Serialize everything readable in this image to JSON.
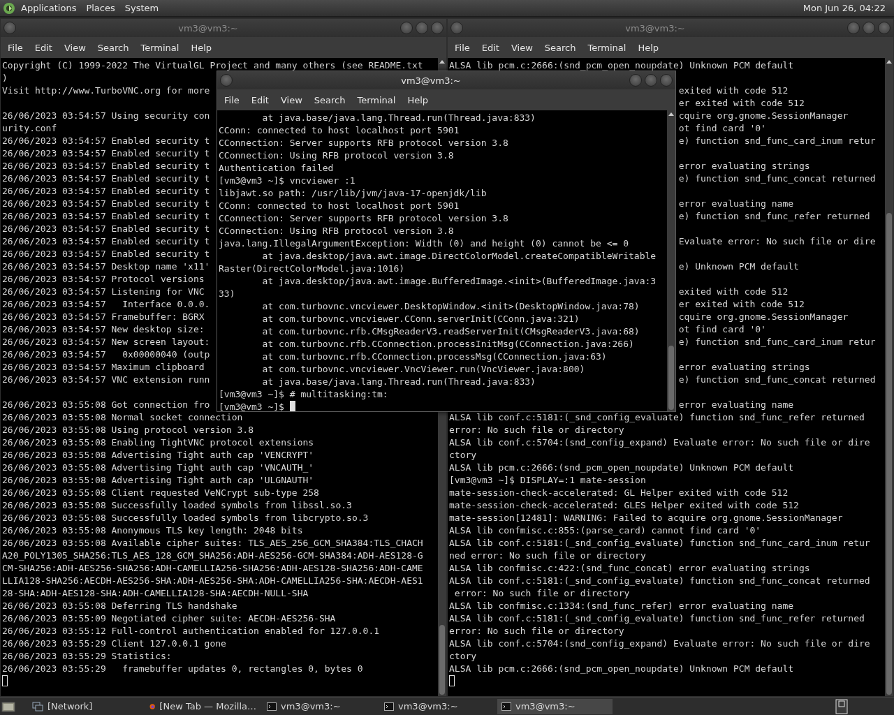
{
  "top_panel": {
    "menus": [
      "Applications",
      "Places",
      "System"
    ],
    "clock": "Mon Jun 26, 04:22"
  },
  "terminals": [
    {
      "title": "vm3@vm3:~",
      "focused": false,
      "menu": [
        "File",
        "Edit",
        "View",
        "Search",
        "Terminal",
        "Help"
      ],
      "lines": [
        {
          "kind": "text",
          "text": "Copyright (C) 1999-2022 The VirtualGL Project and many others (see README.txt"
        },
        {
          "kind": "text",
          "text": ")"
        },
        {
          "kind": "text",
          "text": "Visit http://www.TurboVNC.org for more"
        },
        {
          "kind": "blank"
        },
        {
          "kind": "text",
          "text": "26/06/2023 03:54:57 Using security con"
        },
        {
          "kind": "text",
          "text": "urity.conf"
        },
        {
          "kind": "text",
          "text": "26/06/2023 03:54:57 Enabled security t"
        },
        {
          "kind": "text",
          "text": "26/06/2023 03:54:57 Enabled security t"
        },
        {
          "kind": "text",
          "text": "26/06/2023 03:54:57 Enabled security t"
        },
        {
          "kind": "text",
          "text": "26/06/2023 03:54:57 Enabled security t"
        },
        {
          "kind": "text",
          "text": "26/06/2023 03:54:57 Enabled security t"
        },
        {
          "kind": "text",
          "text": "26/06/2023 03:54:57 Enabled security t"
        },
        {
          "kind": "text",
          "text": "26/06/2023 03:54:57 Enabled security t"
        },
        {
          "kind": "text",
          "text": "26/06/2023 03:54:57 Enabled security t"
        },
        {
          "kind": "text",
          "text": "26/06/2023 03:54:57 Enabled security t"
        },
        {
          "kind": "text",
          "text": "26/06/2023 03:54:57 Enabled security t"
        },
        {
          "kind": "text",
          "text": "26/06/2023 03:54:57 Desktop name 'x11'"
        },
        {
          "kind": "text",
          "text": "26/06/2023 03:54:57 Protocol versions"
        },
        {
          "kind": "text",
          "text": "26/06/2023 03:54:57 Listening for VNC"
        },
        {
          "kind": "text",
          "text": "26/06/2023 03:54:57   Interface 0.0.0."
        },
        {
          "kind": "text",
          "text": "26/06/2023 03:54:57 Framebuffer: BGRX"
        },
        {
          "kind": "text",
          "text": "26/06/2023 03:54:57 New desktop size:"
        },
        {
          "kind": "text",
          "text": "26/06/2023 03:54:57 New screen layout:"
        },
        {
          "kind": "text",
          "text": "26/06/2023 03:54:57   0x00000040 (outp"
        },
        {
          "kind": "text",
          "text": "26/06/2023 03:54:57 Maximum clipboard"
        },
        {
          "kind": "text",
          "text": "26/06/2023 03:54:57 VNC extension runn"
        },
        {
          "kind": "blank"
        },
        {
          "kind": "text",
          "text": "26/06/2023 03:55:08 Got connection fro"
        },
        {
          "kind": "text",
          "text": "26/06/2023 03:55:08 Normal socket connection"
        },
        {
          "kind": "text",
          "text": "26/06/2023 03:55:08 Using protocol version 3.8"
        },
        {
          "kind": "text",
          "text": "26/06/2023 03:55:08 Enabling TightVNC protocol extensions"
        },
        {
          "kind": "text",
          "text": "26/06/2023 03:55:08 Advertising Tight auth cap 'VENCRYPT'"
        },
        {
          "kind": "text",
          "text": "26/06/2023 03:55:08 Advertising Tight auth cap 'VNCAUTH_'"
        },
        {
          "kind": "text",
          "text": "26/06/2023 03:55:08 Advertising Tight auth cap 'ULGNAUTH'"
        },
        {
          "kind": "text",
          "text": "26/06/2023 03:55:08 Client requested VeNCrypt sub-type 258"
        },
        {
          "kind": "text",
          "text": "26/06/2023 03:55:08 Successfully loaded symbols from libssl.so.3"
        },
        {
          "kind": "text",
          "text": "26/06/2023 03:55:08 Successfully loaded symbols from libcrypto.so.3"
        },
        {
          "kind": "text",
          "text": "26/06/2023 03:55:08 Anonymous TLS key length: 2048 bits"
        },
        {
          "kind": "text",
          "text": "26/06/2023 03:55:08 Available cipher suites: TLS_AES_256_GCM_SHA384:TLS_CHACH"
        },
        {
          "kind": "text",
          "text": "A20_POLY1305_SHA256:TLS_AES_128_GCM_SHA256:ADH-AES256-GCM-SHA384:ADH-AES128-G"
        },
        {
          "kind": "text",
          "text": "CM-SHA256:ADH-AES256-SHA256:ADH-CAMELLIA256-SHA256:ADH-AES128-SHA256:ADH-CAME"
        },
        {
          "kind": "text",
          "text": "LLIA128-SHA256:AECDH-AES256-SHA:ADH-AES256-SHA:ADH-CAMELLIA256-SHA:AECDH-AES1"
        },
        {
          "kind": "text",
          "text": "28-SHA:ADH-AES128-SHA:ADH-CAMELLIA128-SHA:AECDH-NULL-SHA"
        },
        {
          "kind": "text",
          "text": "26/06/2023 03:55:08 Deferring TLS handshake"
        },
        {
          "kind": "text",
          "text": "26/06/2023 03:55:09 Negotiated cipher suite: AECDH-AES256-SHA"
        },
        {
          "kind": "text",
          "text": "26/06/2023 03:55:12 Full-control authentication enabled for 127.0.0.1"
        },
        {
          "kind": "text",
          "text": "26/06/2023 03:55:29 Client 127.0.0.1 gone"
        },
        {
          "kind": "text",
          "text": "26/06/2023 03:55:29 Statistics:"
        },
        {
          "kind": "text",
          "text": "26/06/2023 03:55:29   framebuffer updates 0, rectangles 0, bytes 0"
        },
        {
          "kind": "cursor"
        }
      ]
    },
    {
      "title": "vm3@vm3:~",
      "focused": true,
      "menu": [
        "File",
        "Edit",
        "View",
        "Search",
        "Terminal",
        "Help"
      ],
      "lines": [
        {
          "kind": "text",
          "text": "        at java.base/java.lang.Thread.run(Thread.java:833)"
        },
        {
          "kind": "text",
          "text": "CConn: connected to host localhost port 5901"
        },
        {
          "kind": "text",
          "text": "CConnection: Server supports RFB protocol version 3.8"
        },
        {
          "kind": "text",
          "text": "CConnection: Using RFB protocol version 3.8"
        },
        {
          "kind": "text",
          "text": "Authentication failed"
        },
        {
          "kind": "text",
          "text": "[vm3@vm3 ~]$ vncviewer :1"
        },
        {
          "kind": "text",
          "text": "libjawt.so path: /usr/lib/jvm/java-17-openjdk/lib"
        },
        {
          "kind": "text",
          "text": "CConn: connected to host localhost port 5901"
        },
        {
          "kind": "text",
          "text": "CConnection: Server supports RFB protocol version 3.8"
        },
        {
          "kind": "text",
          "text": "CConnection: Using RFB protocol version 3.8"
        },
        {
          "kind": "text",
          "text": "java.lang.IllegalArgumentException: Width (0) and height (0) cannot be <= 0"
        },
        {
          "kind": "text",
          "text": "        at java.desktop/java.awt.image.DirectColorModel.createCompatibleWritable"
        },
        {
          "kind": "text",
          "text": "Raster(DirectColorModel.java:1016)"
        },
        {
          "kind": "text",
          "text": "        at java.desktop/java.awt.image.BufferedImage.<init>(BufferedImage.java:3"
        },
        {
          "kind": "text",
          "text": "33)"
        },
        {
          "kind": "text",
          "text": "        at com.turbovnc.vncviewer.DesktopWindow.<init>(DesktopWindow.java:78)"
        },
        {
          "kind": "text",
          "text": "        at com.turbovnc.vncviewer.CConn.serverInit(CConn.java:321)"
        },
        {
          "kind": "text",
          "text": "        at com.turbovnc.rfb.CMsgReaderV3.readServerInit(CMsgReaderV3.java:68)"
        },
        {
          "kind": "text",
          "text": "        at com.turbovnc.rfb.CConnection.processInitMsg(CConnection.java:266)"
        },
        {
          "kind": "text",
          "text": "        at com.turbovnc.rfb.CConnection.processMsg(CConnection.java:63)"
        },
        {
          "kind": "text",
          "text": "        at com.turbovnc.vncviewer.VncViewer.run(VncViewer.java:800)"
        },
        {
          "kind": "text",
          "text": "        at java.base/java.lang.Thread.run(Thread.java:833)"
        },
        {
          "kind": "text",
          "text": "[vm3@vm3 ~]$ # multitasking:tm:"
        },
        {
          "kind": "cursor",
          "text": "[vm3@vm3 ~]$ "
        }
      ]
    },
    {
      "title": "vm3@vm3:~",
      "focused": false,
      "menu": [
        "File",
        "Edit",
        "View",
        "Search",
        "Terminal",
        "Help"
      ],
      "lines": [
        {
          "kind": "text",
          "text": "ALSA lib pcm.c:2666:(snd_pcm_open_noupdate) Unknown PCM default"
        },
        {
          "kind": "blank"
        },
        {
          "kind": "fragment",
          "text": "exited with code 512"
        },
        {
          "kind": "fragment",
          "text": "er exited with code 512"
        },
        {
          "kind": "fragment",
          "text": "cquire org.gnome.SessionManager"
        },
        {
          "kind": "fragment",
          "text": "ot find card '0'"
        },
        {
          "kind": "fragment",
          "text": "e) function snd_func_card_inum retur"
        },
        {
          "kind": "blank"
        },
        {
          "kind": "fragment",
          "text": "error evaluating strings"
        },
        {
          "kind": "fragment",
          "text": "e) function snd_func_concat returned"
        },
        {
          "kind": "blank"
        },
        {
          "kind": "fragment",
          "text": "error evaluating name"
        },
        {
          "kind": "fragment",
          "text": "e) function snd_func_refer returned"
        },
        {
          "kind": "blank"
        },
        {
          "kind": "fragment",
          "text": "Evaluate error: No such file or dire"
        },
        {
          "kind": "blank"
        },
        {
          "kind": "fragment",
          "text": "e) Unknown PCM default"
        },
        {
          "kind": "blank"
        },
        {
          "kind": "fragment",
          "text": "exited with code 512"
        },
        {
          "kind": "fragment",
          "text": "er exited with code 512"
        },
        {
          "kind": "fragment",
          "text": "cquire org.gnome.SessionManager"
        },
        {
          "kind": "fragment",
          "text": "ot find card '0'"
        },
        {
          "kind": "fragment",
          "text": "e) function snd_func_card_inum retur"
        },
        {
          "kind": "blank"
        },
        {
          "kind": "fragment",
          "text": "error evaluating strings"
        },
        {
          "kind": "fragment",
          "text": "e) function snd_func_concat returned"
        },
        {
          "kind": "blank"
        },
        {
          "kind": "fragment",
          "text": "error evaluating name"
        },
        {
          "kind": "text",
          "text": "ALSA lib conf.c:5181:(_snd_config_evaluate) function snd_func_refer returned"
        },
        {
          "kind": "text",
          "text": "error: No such file or directory"
        },
        {
          "kind": "text",
          "text": "ALSA lib conf.c:5704:(snd_config_expand) Evaluate error: No such file or dire"
        },
        {
          "kind": "text",
          "text": "ctory"
        },
        {
          "kind": "text",
          "text": "ALSA lib pcm.c:2666:(snd_pcm_open_noupdate) Unknown PCM default"
        },
        {
          "kind": "text",
          "text": "[vm3@vm3 ~]$ DISPLAY=:1 mate-session"
        },
        {
          "kind": "text",
          "text": "mate-session-check-accelerated: GL Helper exited with code 512"
        },
        {
          "kind": "text",
          "text": "mate-session-check-accelerated: GLES Helper exited with code 512"
        },
        {
          "kind": "text",
          "text": "mate-session[12481]: WARNING: Failed to acquire org.gnome.SessionManager"
        },
        {
          "kind": "text",
          "text": "ALSA lib confmisc.c:855:(parse_card) cannot find card '0'"
        },
        {
          "kind": "text",
          "text": "ALSA lib conf.c:5181:(_snd_config_evaluate) function snd_func_card_inum retur"
        },
        {
          "kind": "text",
          "text": "ned error: No such file or directory"
        },
        {
          "kind": "text",
          "text": "ALSA lib confmisc.c:422:(snd_func_concat) error evaluating strings"
        },
        {
          "kind": "text",
          "text": "ALSA lib conf.c:5181:(_snd_config_evaluate) function snd_func_concat returned"
        },
        {
          "kind": "text",
          "text": " error: No such file or directory"
        },
        {
          "kind": "text",
          "text": "ALSA lib confmisc.c:1334:(snd_func_refer) error evaluating name"
        },
        {
          "kind": "text",
          "text": "ALSA lib conf.c:5181:(_snd_config_evaluate) function snd_func_refer returned"
        },
        {
          "kind": "text",
          "text": "error: No such file or directory"
        },
        {
          "kind": "text",
          "text": "ALSA lib conf.c:5704:(snd_config_expand) Evaluate error: No such file or dire"
        },
        {
          "kind": "text",
          "text": "ctory"
        },
        {
          "kind": "text",
          "text": "ALSA lib pcm.c:2666:(snd_pcm_open_noupdate) Unknown PCM default"
        },
        {
          "kind": "cursor"
        }
      ]
    }
  ],
  "taskbar": {
    "items": [
      {
        "kind": "window",
        "label": "[Network]",
        "selected": false
      },
      {
        "kind": "browser",
        "label": "[New Tab — Mozilla…",
        "selected": false
      },
      {
        "kind": "terminal",
        "label": "vm3@vm3:~",
        "selected": false
      },
      {
        "kind": "terminal",
        "label": "vm3@vm3:~",
        "selected": false
      },
      {
        "kind": "terminal",
        "label": "vm3@vm3:~",
        "selected": true
      }
    ]
  }
}
